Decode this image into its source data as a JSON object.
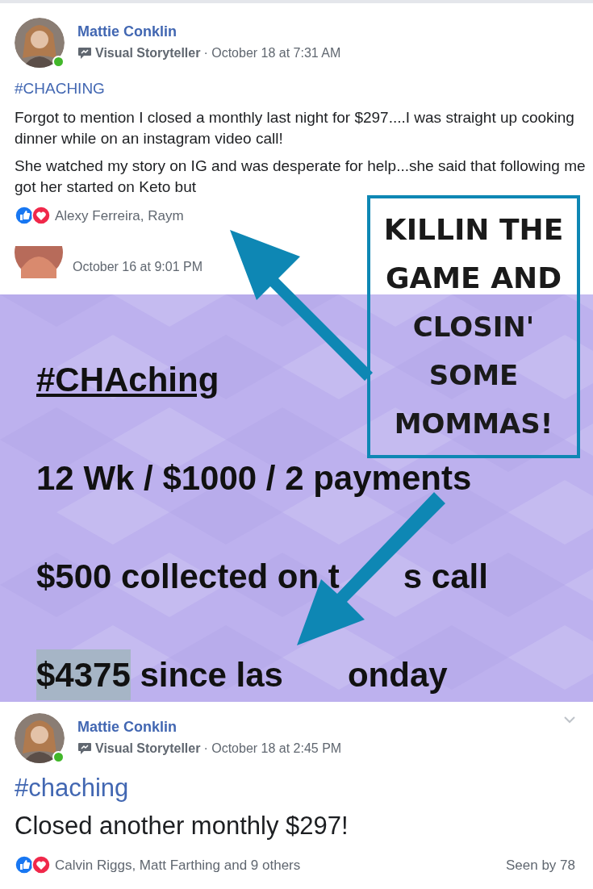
{
  "post_1": {
    "author": "Mattie Conklin",
    "online": true,
    "badge": "Visual Storyteller",
    "time": "· October 18 at 7:31 AM",
    "hashtag": "#CHACHING",
    "paragraphs": [
      "Forgot to mention I closed a monthly last night for $297....I was straight up cooking dinner while on an instagram video call!",
      "She watched my story on IG and was desperate for help...she said that following me got her started on Keto but"
    ],
    "reactions": "Alexy Ferreira, Raym"
  },
  "post_2": {
    "time": "October 16 at 9:01 PM"
  },
  "story_image": {
    "lines": [
      {
        "kind": "heading",
        "text": "#CHAching"
      },
      {
        "kind": "plain",
        "text": "12 Wk / $1000 / 2 payments"
      },
      {
        "kind": "split",
        "text": "$500 collected on t",
        "after": "s call"
      },
      {
        "kind": "highlight",
        "highlighted": "$4375",
        "text": " since las",
        "after": "onday"
      }
    ]
  },
  "callout": {
    "lines": [
      "KILLIN THE",
      "GAME AND",
      "CLOSIN'",
      "SOME",
      "MOMMAS!"
    ]
  },
  "post_3": {
    "author": "Mattie Conklin",
    "online": true,
    "badge": "Visual Storyteller",
    "time": "· October 18 at 2:45 PM",
    "hashtag": "#chaching",
    "text": "Closed another monthly $297!",
    "reactions": "Calvin Riggs, Matt Farthing and 9 others",
    "seen": "Seen by 78"
  }
}
